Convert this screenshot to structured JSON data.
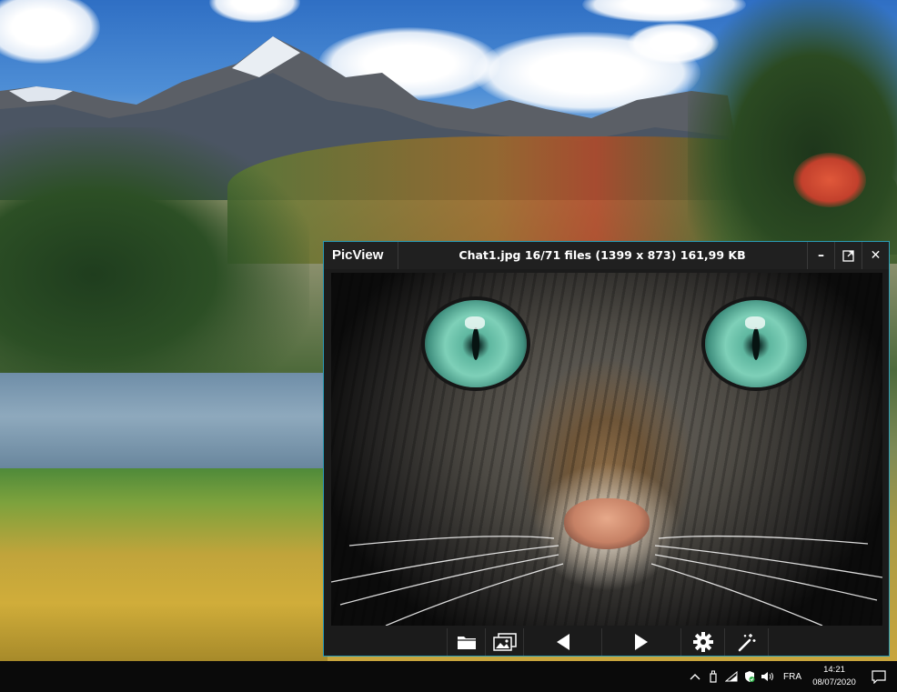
{
  "window": {
    "app_name": "PicView",
    "title": "Chat1.jpg 16/71 files (1399 x 873) 161,99 KB",
    "accent_color": "#2a9bb5",
    "controls": {
      "minimize_symbol": "–",
      "maximize_icon": "expand-icon",
      "close_symbol": "✕"
    }
  },
  "toolbar": {
    "buttons": [
      {
        "name": "open-folder-button",
        "icon": "folder-icon"
      },
      {
        "name": "gallery-button",
        "icon": "images-icon"
      },
      {
        "name": "previous-button",
        "icon": "triangle-left-icon"
      },
      {
        "name": "next-button",
        "icon": "triangle-right-icon"
      },
      {
        "name": "settings-button",
        "icon": "gear-icon"
      },
      {
        "name": "effects-button",
        "icon": "magic-wand-icon"
      }
    ]
  },
  "taskbar": {
    "tray": {
      "chevron_symbol": "^",
      "language": "FRA",
      "time": "14:21",
      "date": "08/07/2020"
    }
  }
}
